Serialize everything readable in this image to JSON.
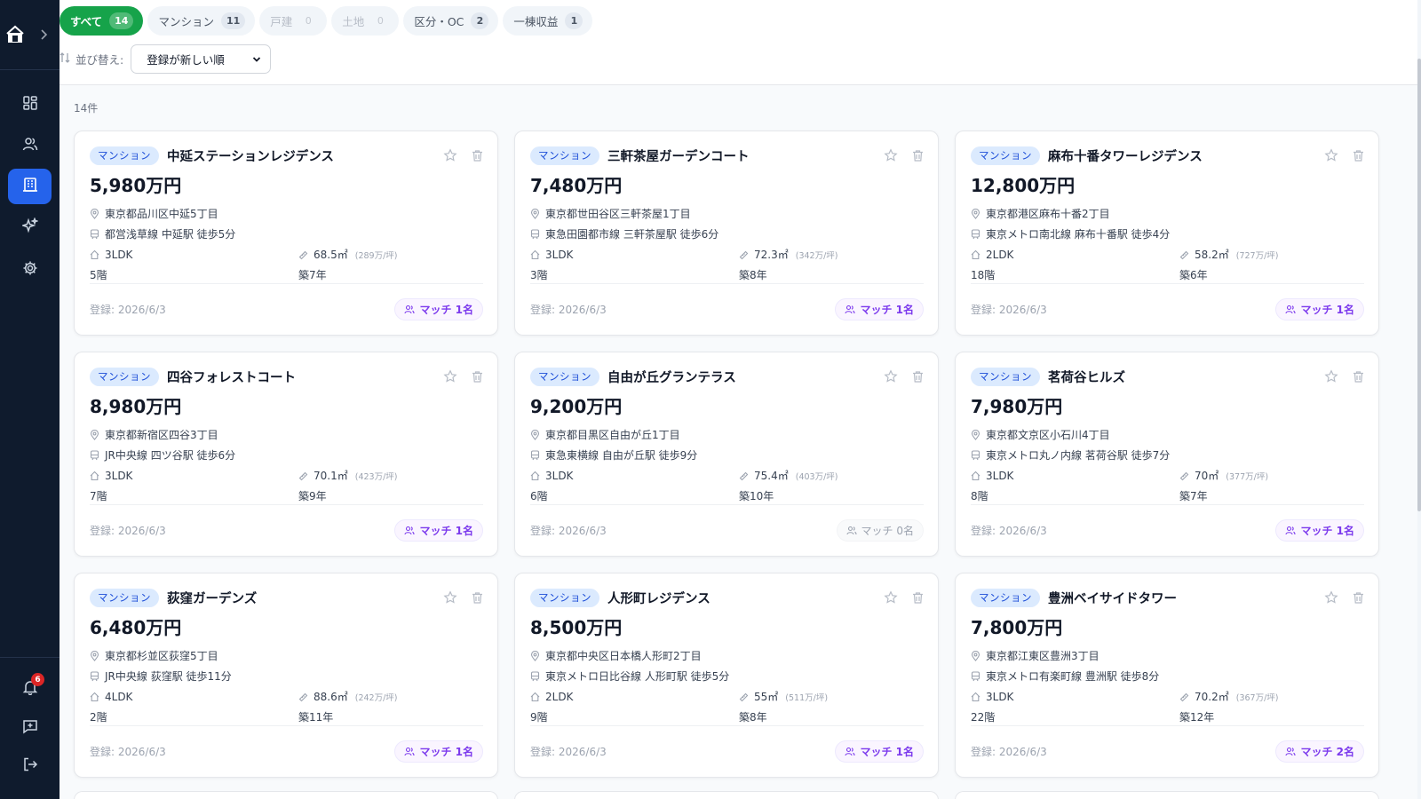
{
  "tabs": [
    {
      "label": "すべて",
      "count": "14",
      "state": "active"
    },
    {
      "label": "マンション",
      "count": "11",
      "state": "normal"
    },
    {
      "label": "戸建",
      "count": "0",
      "state": "disabled"
    },
    {
      "label": "土地",
      "count": "0",
      "state": "disabled"
    },
    {
      "label": "区分・OC",
      "count": "2",
      "state": "normal"
    },
    {
      "label": "一棟収益",
      "count": "1",
      "state": "normal"
    }
  ],
  "sort": {
    "label": "並び替え:",
    "selected": "登録が新しい順"
  },
  "result_count": "14件",
  "notifications": {
    "count": "6"
  },
  "colors": {
    "sidebar": "#0f1b2d",
    "accent_active_nav": "#2563eb",
    "tab_active": "#16a34a",
    "match": "#7c3aed"
  },
  "listings": [
    {
      "type": "マンション",
      "name": "中延ステーションレジデンス",
      "price": "5,980万円",
      "address": "東京都品川区中延5丁目",
      "station": "都営浅草線 中延駅 徒歩5分",
      "layout": "3LDK",
      "area": "68.5㎡",
      "tsubo_price": "(289万/坪)",
      "floor": "5階",
      "age": "築7年",
      "registered": "登録: 2026/6/3",
      "match": "マッチ 1名",
      "match_count": 1
    },
    {
      "type": "マンション",
      "name": "三軒茶屋ガーデンコート",
      "price": "7,480万円",
      "address": "東京都世田谷区三軒茶屋1丁目",
      "station": "東急田園都市線 三軒茶屋駅 徒歩6分",
      "layout": "3LDK",
      "area": "72.3㎡",
      "tsubo_price": "(342万/坪)",
      "floor": "3階",
      "age": "築8年",
      "registered": "登録: 2026/6/3",
      "match": "マッチ 1名",
      "match_count": 1
    },
    {
      "type": "マンション",
      "name": "麻布十番タワーレジデンス",
      "price": "12,800万円",
      "address": "東京都港区麻布十番2丁目",
      "station": "東京メトロ南北線 麻布十番駅 徒歩4分",
      "layout": "2LDK",
      "area": "58.2㎡",
      "tsubo_price": "(727万/坪)",
      "floor": "18階",
      "age": "築6年",
      "registered": "登録: 2026/6/3",
      "match": "マッチ 1名",
      "match_count": 1
    },
    {
      "type": "マンション",
      "name": "四谷フォレストコート",
      "price": "8,980万円",
      "address": "東京都新宿区四谷3丁目",
      "station": "JR中央線 四ツ谷駅 徒歩6分",
      "layout": "3LDK",
      "area": "70.1㎡",
      "tsubo_price": "(423万/坪)",
      "floor": "7階",
      "age": "築9年",
      "registered": "登録: 2026/6/3",
      "match": "マッチ 1名",
      "match_count": 1
    },
    {
      "type": "マンション",
      "name": "自由が丘グランテラス",
      "price": "9,200万円",
      "address": "東京都目黒区自由が丘1丁目",
      "station": "東急東横線 自由が丘駅 徒歩9分",
      "layout": "3LDK",
      "area": "75.4㎡",
      "tsubo_price": "(403万/坪)",
      "floor": "6階",
      "age": "築10年",
      "registered": "登録: 2026/6/3",
      "match": "マッチ 0名",
      "match_count": 0
    },
    {
      "type": "マンション",
      "name": "茗荷谷ヒルズ",
      "price": "7,980万円",
      "address": "東京都文京区小石川4丁目",
      "station": "東京メトロ丸ノ内線 茗荷谷駅 徒歩7分",
      "layout": "3LDK",
      "area": "70㎡",
      "tsubo_price": "(377万/坪)",
      "floor": "8階",
      "age": "築7年",
      "registered": "登録: 2026/6/3",
      "match": "マッチ 1名",
      "match_count": 1
    },
    {
      "type": "マンション",
      "name": "荻窪ガーデンズ",
      "price": "6,480万円",
      "address": "東京都杉並区荻窪5丁目",
      "station": "JR中央線 荻窪駅 徒歩11分",
      "layout": "4LDK",
      "area": "88.6㎡",
      "tsubo_price": "(242万/坪)",
      "floor": "2階",
      "age": "築11年",
      "registered": "登録: 2026/6/3",
      "match": "マッチ 1名",
      "match_count": 1
    },
    {
      "type": "マンション",
      "name": "人形町レジデンス",
      "price": "8,500万円",
      "address": "東京都中央区日本橋人形町2丁目",
      "station": "東京メトロ日比谷線 人形町駅 徒歩5分",
      "layout": "2LDK",
      "area": "55㎡",
      "tsubo_price": "(511万/坪)",
      "floor": "9階",
      "age": "築8年",
      "registered": "登録: 2026/6/3",
      "match": "マッチ 1名",
      "match_count": 1
    },
    {
      "type": "マンション",
      "name": "豊洲ベイサイドタワー",
      "price": "7,800万円",
      "address": "東京都江東区豊洲3丁目",
      "station": "東京メトロ有楽町線 豊洲駅 徒歩8分",
      "layout": "3LDK",
      "area": "70.2㎡",
      "tsubo_price": "(367万/坪)",
      "floor": "22階",
      "age": "築12年",
      "registered": "登録: 2026/6/3",
      "match": "マッチ 2名",
      "match_count": 2
    }
  ]
}
